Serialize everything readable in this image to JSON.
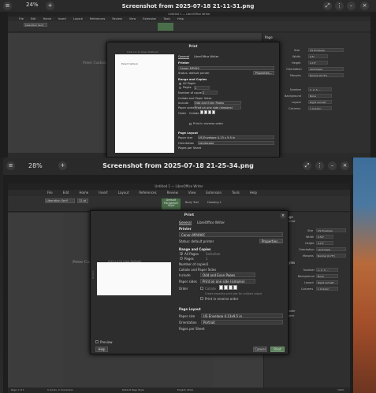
{
  "back_window": {
    "zoom": "24%",
    "title": "Screenshot from 2025-07-18 21-11-31.png",
    "lo_title": "Untitled 1 — LibreOffice Writer",
    "menu": [
      "File",
      "Edit",
      "Home",
      "Insert",
      "Layout",
      "References",
      "Review",
      "View",
      "Extension",
      "Tools",
      "Help"
    ],
    "font_name": "Liberation Serif",
    "doc_text": "Peter Carlson",
    "sidebar": {
      "header": "Page",
      "sub": "Format",
      "rows": [
        {
          "label": "Size",
          "value": "US Envelope"
        },
        {
          "label": "Width",
          "value": "9.5\""
        },
        {
          "label": "Height",
          "value": "4.13\""
        },
        {
          "label": "Orientation",
          "value": "Landscape"
        },
        {
          "label": "Margins",
          "value": "Normal (0.75\")"
        }
      ],
      "styles": "Styles",
      "style_rows": [
        {
          "label": "Number",
          "value": "1, 2, 3, ..."
        },
        {
          "label": "Background",
          "value": "None"
        },
        {
          "label": "Layout",
          "value": "Right and left"
        },
        {
          "label": "Columns",
          "value": "1 Column"
        }
      ],
      "header_footer": [
        "Header",
        "Footer"
      ]
    },
    "dialog": {
      "title": "Print",
      "preview_label": "0.00 x 6.13 (User Defined)",
      "preview_text": "Peter Carlson",
      "tabs": [
        "General",
        "LibreOffice Writer"
      ],
      "printer_head": "Printer",
      "printer": "Canon MP490",
      "status": "Status: default printer",
      "properties": "Properties...",
      "range_head": "Range and Copies",
      "all_pages": "All Pages",
      "pages": "Pages",
      "pages_val": "1",
      "copies_label": "Number of copies",
      "copies": "1",
      "collate_head": "Collate and Paper Sides",
      "include_label": "Include",
      "include": "Odd and Even Pages",
      "paper_sides_label": "Paper sides",
      "paper_sides": "Print on one side (simplex)",
      "order_label": "Order",
      "collate": "Collate",
      "reverse": "Print in reverse order",
      "layout_head": "Page Layout",
      "paper_size_label": "Paper size",
      "paper_size": "US Envelope 4.13 x 9.5 in",
      "orientation_label": "Orientation",
      "orientation": "Landscape",
      "pages_per_sheet": "Pages per Sheet"
    }
  },
  "front_window": {
    "zoom": "28%",
    "title": "Screenshot from 2025-07-18 21-25-34.png",
    "lo_title": "Untitled 1 — LibreOffice Writer",
    "menu": [
      "File",
      "Edit",
      "Home",
      "Insert",
      "Layout",
      "References",
      "Review",
      "View",
      "Extension",
      "Tools",
      "Help"
    ],
    "font_name": "Liberation Serif",
    "font_size": "12 pt",
    "style_box": "Default Paragraph Style",
    "style_name": "Body Text",
    "heading": "Heading 1",
    "doc_text": "Peter Carlson",
    "statusbar": {
      "page": "Page 1 of 1",
      "words": "0 words, 0 characters",
      "style": "Default Page Style",
      "lang": "English (USA)",
      "zoom": "100%"
    },
    "sidebar": {
      "header": "Page",
      "sub": "Format",
      "rows": [
        {
          "label": "Size",
          "value": "US Envelope"
        },
        {
          "label": "Width",
          "value": "9.50\""
        },
        {
          "label": "Height",
          "value": "4.13\""
        },
        {
          "label": "Orientation",
          "value": "Landscape"
        },
        {
          "label": "Margins",
          "value": "Normal (0.75\")"
        }
      ],
      "styles": "Styles",
      "style_rows": [
        {
          "label": "Number",
          "value": "1, 2, 3, ..."
        },
        {
          "label": "Background",
          "value": "None"
        },
        {
          "label": "Layout",
          "value": "Right and left"
        },
        {
          "label": "Columns",
          "value": "1 Column"
        }
      ],
      "header_footer": [
        "Header",
        "Footer"
      ]
    },
    "dialog": {
      "title": "Print",
      "preview_label": "6.93 x 4.13 (User Defined)",
      "preview_side": "4.13 in",
      "preview_check": "Preview",
      "tabs": [
        "General",
        "LibreOffice Writer"
      ],
      "printer_head": "Printer",
      "printer": "Canon MP490C",
      "status": "Status: default printer",
      "properties": "Properties...",
      "range_head": "Range and Copies",
      "all_pages": "All Pages",
      "all_pages_val": "Selection",
      "pages": "Pages",
      "pages_val": "1",
      "copies_label": "Number of copies",
      "copies": "1",
      "collate_head": "Collate and Paper Sides",
      "include_label": "Include",
      "include": "Odd and Even Pages",
      "paper_sides_label": "Paper sides",
      "paper_sides": "Print on one side (simplex)",
      "order_label": "Order",
      "collate": "Collate",
      "collate_note": "Create separate print jobs for collated output",
      "reverse": "Print in reverse order",
      "layout_head": "Page Layout",
      "paper_size_label": "Paper size",
      "paper_size": "US Envelope 4.13x9.5 in",
      "orientation_label": "Orientation",
      "orientation": "Portrait",
      "pages_per_sheet": "Pages per Sheet",
      "help": "Help",
      "cancel": "Cancel",
      "print": "Print"
    }
  }
}
